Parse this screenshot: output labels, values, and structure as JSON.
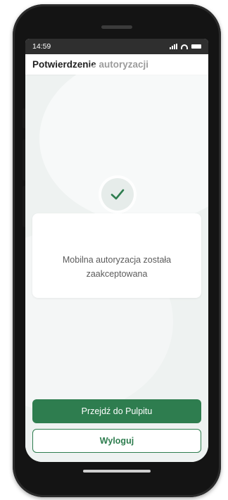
{
  "status_bar": {
    "time": "14:59"
  },
  "header": {
    "title": "Potwierdzenie autoryzacji"
  },
  "confirmation": {
    "message": "Mobilna autoryzacja została zaakceptowana",
    "icon": "checkmark-icon",
    "icon_color": "#2e7d4f"
  },
  "actions": {
    "primary_label": "Przejdź do Pulpitu",
    "secondary_label": "Wyloguj"
  },
  "colors": {
    "accent": "#2e7d4f",
    "background": "#eef2f1"
  }
}
